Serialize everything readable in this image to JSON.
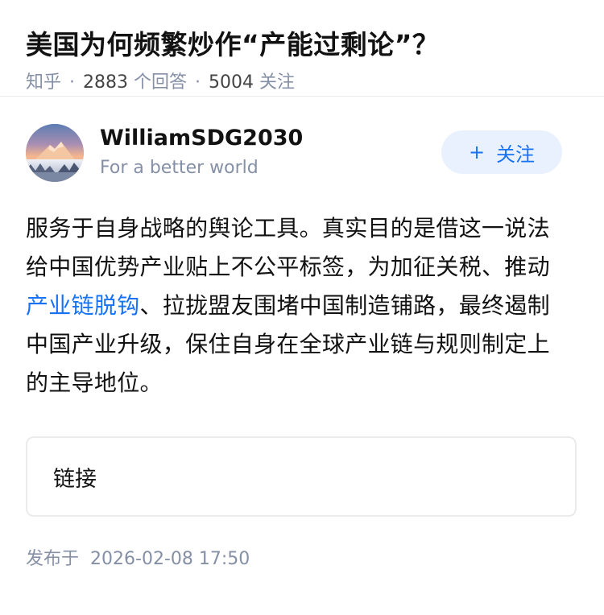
{
  "question": {
    "title": "美国为何频繁炒作“产能过剩论”？",
    "source": "知乎",
    "separator": "·",
    "answer_count": "2883",
    "answer_count_label": "个回答",
    "follower_count": "5004",
    "follower_count_label": "关注"
  },
  "author": {
    "name": "WilliamSDG2030",
    "bio": "For a better world",
    "avatar_icon": "mountain-sunset-avatar",
    "follow_plus": "+",
    "follow_label": "关注"
  },
  "answer": {
    "text_before_link": "服务于自身战略的舆论工具。真实目的是借这一说法给中国优势产业贴上不公平标签，为加征关税、推动",
    "link_text": "产业链脱钩",
    "text_after_link": "、拉拢盟友围堵中国制造铺路，最终遏制中国产业升级，保住自身在全球产业链与规则制定上的主导地位。",
    "link_card_label": "链接"
  },
  "publish": {
    "label": "发布于",
    "datetime": "2026-02-08 17:50"
  },
  "colors": {
    "accent": "#1772f6",
    "follow_bg": "#e8f1fd",
    "meta_gray": "#8590a6"
  }
}
